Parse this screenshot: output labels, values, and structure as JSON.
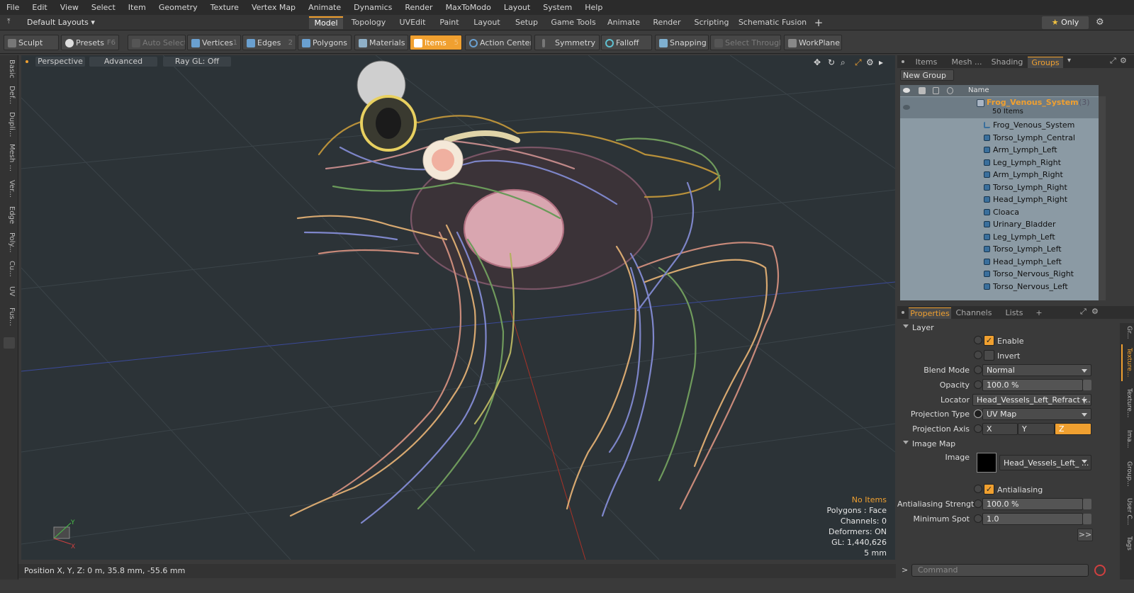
{
  "menu": [
    "File",
    "Edit",
    "View",
    "Select",
    "Item",
    "Geometry",
    "Texture",
    "Vertex Map",
    "Animate",
    "Dynamics",
    "Render",
    "MaxToModo",
    "Layout",
    "System",
    "Help"
  ],
  "layout_bar": {
    "layout_name": "Default Layouts",
    "tabs": [
      "Model",
      "Topology",
      "UVEdit",
      "Paint",
      "Layout",
      "Setup",
      "Game Tools",
      "Animate",
      "Render",
      "Scripting",
      "Schematic Fusion"
    ],
    "active_tab": "Model",
    "add_tab": "+",
    "only": "Only"
  },
  "toolbar": {
    "sculpt": "Sculpt",
    "presets": "Presets",
    "presets_key": "F6",
    "auto_select": "Auto Select",
    "vertices": "Vertices",
    "vertices_key": "1",
    "edges": "Edges",
    "edges_key": "2",
    "polygons": "Polygons",
    "materials": "Materials",
    "items": "Items",
    "items_key": "5",
    "action_center": "Action Center",
    "symmetry": "Symmetry",
    "falloff": "Falloff",
    "snapping": "Snapping",
    "select_through": "Select Through",
    "workplane": "WorkPlane"
  },
  "left_tabs": [
    "Basic",
    "Def...",
    "Dupli...",
    "Mesh ...",
    "Ver...",
    "Edge",
    "Poly...",
    "Cu...",
    "UV",
    "Fus..."
  ],
  "viewport": {
    "view": "Perspective",
    "shading": "Advanced",
    "raygl": "Ray GL: Off",
    "info": {
      "no_items": "No Items",
      "polygons": "Polygons : Face",
      "channels": "Channels: 0",
      "deformers": "Deformers: ON",
      "gl": "GL: 1,440,626",
      "scale": "5 mm"
    }
  },
  "status": {
    "position": "Position X, Y, Z:  0 m, 35.8 mm, -55.6 mm"
  },
  "right_top": {
    "tabs": [
      "Items",
      "Mesh ...",
      "Shading",
      "Groups"
    ],
    "active": "Groups",
    "new_group": "New Group",
    "name_header": "Name",
    "group_name": "Frog_Venous_System",
    "group_count": "(3)",
    "group_items": "50 Items",
    "items": [
      "Frog_Venous_System",
      "Torso_Lymph_Central",
      "Arm_Lymph_Left",
      "Leg_Lymph_Right",
      "Arm_Lymph_Right",
      "Torso_Lymph_Right",
      "Head_Lymph_Right",
      "Cloaca",
      "Urinary_Bladder",
      "Leg_Lymph_Left",
      "Torso_Lymph_Left",
      "Head_Lymph_Left",
      "Torso_Nervous_Right",
      "Torso_Nervous_Left"
    ]
  },
  "properties": {
    "tabs": [
      "Properties",
      "Channels",
      "Lists"
    ],
    "active": "Properties",
    "add": "+",
    "layer": "Layer",
    "enable": "Enable",
    "invert": "Invert",
    "blend_mode_label": "Blend Mode",
    "blend_mode": "Normal",
    "opacity_label": "Opacity",
    "opacity": "100.0 %",
    "locator_label": "Locator",
    "locator": "Head_Vessels_Left_Refract (...",
    "projection_type_label": "Projection Type",
    "projection_type": "UV Map",
    "projection_axis_label": "Projection Axis",
    "axis_x": "X",
    "axis_y": "Y",
    "axis_z": "Z",
    "image_map": "Image Map",
    "image_label": "Image",
    "image": "Head_Vessels_Left_ ...",
    "antialiasing": "Antialiasing",
    "aa_strength_label": "Antialiasing Strength",
    "aa_strength": "100.0 %",
    "min_spot_label": "Minimum Spot",
    "min_spot": "1.0",
    "more": ">>"
  },
  "right_side_tabs": [
    "Gr...",
    "Texture...",
    "Texture...",
    "Ima...",
    "Group...",
    "User C...",
    "Tags"
  ],
  "command": {
    "placeholder": "Command",
    "prompt": ">"
  },
  "colors": {
    "accent": "#f0a030",
    "list_bg": "#8b9aa4",
    "viewport_bg": "#2c3337"
  }
}
